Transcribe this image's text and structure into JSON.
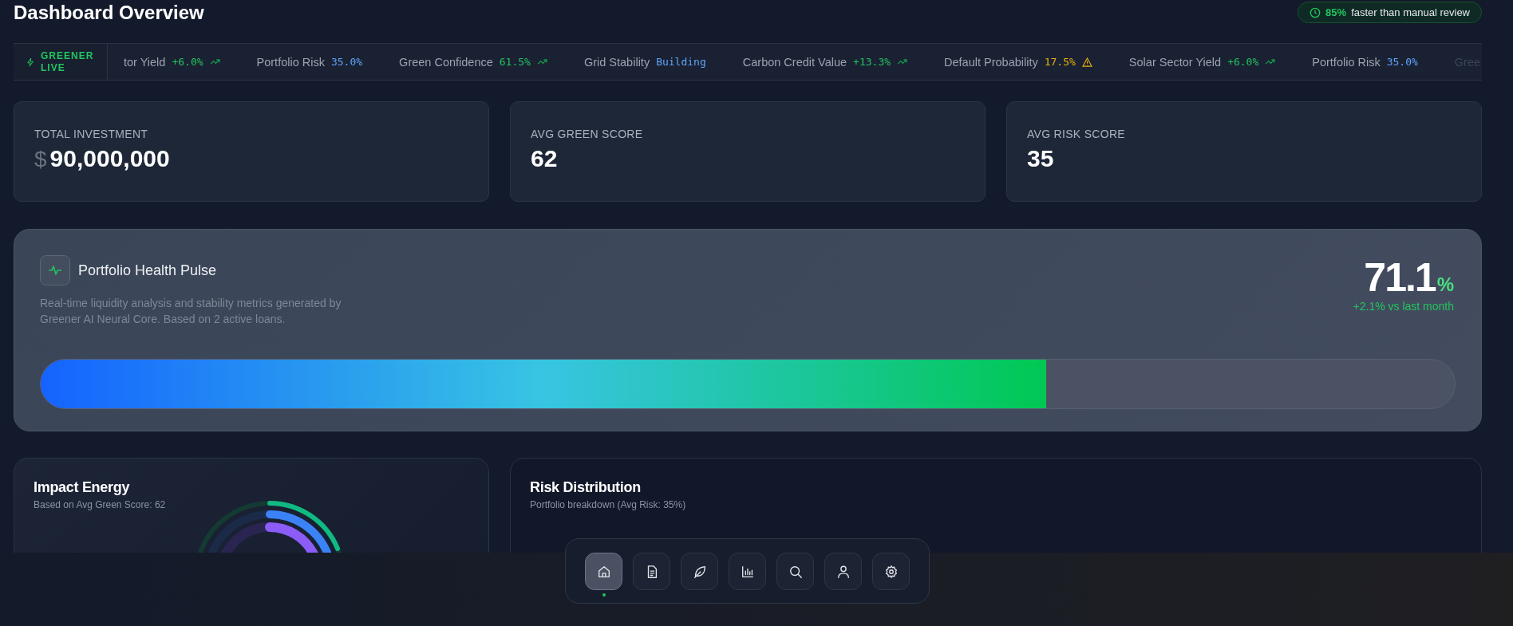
{
  "header": {
    "title": "Dashboard Overview",
    "badge": {
      "highlight": "85%",
      "text": "faster than manual review"
    }
  },
  "ticker": {
    "live_label": "GREENER LIVE",
    "items": [
      {
        "label": "tor Yield",
        "value": "+6.0%",
        "kind": "up"
      },
      {
        "label": "Portfolio Risk",
        "value": "35.0%",
        "kind": "neutral"
      },
      {
        "label": "Green Confidence",
        "value": "61.5%",
        "kind": "up"
      },
      {
        "label": "Grid Stability",
        "value": "Building",
        "kind": "neutral"
      },
      {
        "label": "Carbon Credit Value",
        "value": "+13.3%",
        "kind": "up"
      },
      {
        "label": "Default Probability",
        "value": "17.5%",
        "kind": "warning"
      },
      {
        "label": "Solar Sector Yield",
        "value": "+6.0%",
        "kind": "up"
      },
      {
        "label": "Portfolio Risk",
        "value": "35.0%",
        "kind": "neutral"
      },
      {
        "label": "Gree",
        "kind": "faded"
      }
    ]
  },
  "stats": [
    {
      "label": "TOTAL INVESTMENT",
      "prefix": "$",
      "value": "90,000,000"
    },
    {
      "label": "AVG GREEN SCORE",
      "value": "62"
    },
    {
      "label": "AVG RISK SCORE",
      "value": "35"
    }
  ],
  "pulse": {
    "title": "Portfolio Health Pulse",
    "description": "Real-time liquidity analysis and stability metrics generated by Greener AI Neural Core. Based on 2 active loans.",
    "value": "71.1",
    "unit": "%",
    "change": "+2.1% vs last month",
    "level": 0.711
  },
  "panels": [
    {
      "title": "Impact Energy",
      "subtitle": "Based on Avg Green Score: 62",
      "kind": "rings"
    },
    {
      "title": "Risk Distribution",
      "subtitle": "Portfolio breakdown (Avg Risk: 35%)",
      "kind": "empty"
    }
  ],
  "nav": [
    {
      "kind": "home",
      "selected": true
    },
    {
      "kind": "document",
      "selected": false
    },
    {
      "kind": "leaf",
      "selected": false
    },
    {
      "kind": "chart",
      "selected": false
    },
    {
      "kind": "search",
      "selected": false
    },
    {
      "kind": "user",
      "selected": false
    },
    {
      "kind": "settings",
      "selected": false
    }
  ]
}
